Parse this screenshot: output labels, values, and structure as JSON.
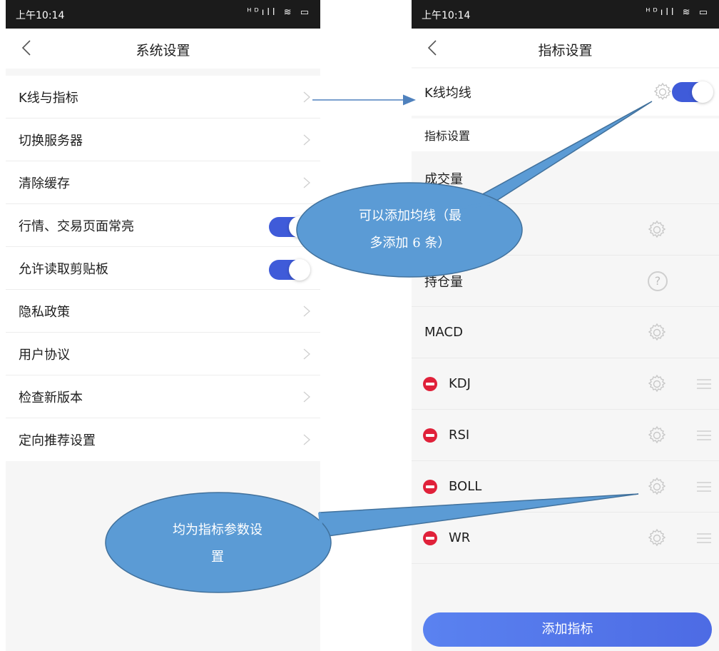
{
  "left": {
    "status_time": "上午10:14",
    "status_icons": "ᴴᴰıll ≋ ▭",
    "nav_title": "系统设置",
    "items": [
      {
        "label": "K线与指标",
        "control": "chevron"
      },
      {
        "label": "切换服务器",
        "control": "chevron"
      },
      {
        "label": "清除缓存",
        "control": "chevron"
      },
      {
        "label": "行情、交易页面常亮",
        "control": "toggle",
        "on": true
      },
      {
        "label": "允许读取剪贴板",
        "control": "toggle",
        "on": true
      },
      {
        "label": "隐私政策",
        "control": "chevron"
      },
      {
        "label": "用户协议",
        "control": "chevron"
      },
      {
        "label": "检查新版本",
        "control": "chevron"
      },
      {
        "label": "定向推荐设置",
        "control": "chevron"
      }
    ]
  },
  "right": {
    "status_time": "上午10:14",
    "status_icons": "ᴴᴰıll ≋ ▭",
    "nav_title": "指标设置",
    "kline_label": "K线均线",
    "kline_toggle_on": true,
    "section_label": "指标设置",
    "rows": [
      {
        "label": "成交量",
        "removable": false,
        "action": "none"
      },
      {
        "label": "",
        "removable": false,
        "action": "gear"
      },
      {
        "label": "持仓量",
        "removable": false,
        "action": "help"
      },
      {
        "label": "MACD",
        "removable": false,
        "action": "gear"
      },
      {
        "label": "KDJ",
        "removable": true,
        "action": "gear"
      },
      {
        "label": "RSI",
        "removable": true,
        "action": "gear"
      },
      {
        "label": "BOLL",
        "removable": true,
        "action": "gear"
      },
      {
        "label": "WR",
        "removable": true,
        "action": "gear"
      }
    ],
    "help_glyph": "?",
    "add_button": "添加指标"
  },
  "annotations": {
    "callout_top_line1": "可以添加均线（最",
    "callout_top_line2": "多添加 6 条）",
    "callout_bottom_line1": "均为指标参数设",
    "callout_bottom_line2": "置"
  },
  "colors": {
    "accent": "#3f5bd9",
    "remove_red": "#e0213a",
    "callout_fill": "#5b9bd5",
    "callout_stroke": "#41719c"
  },
  "icons": {
    "back": "chevron-left-icon",
    "row_chevron": "chevron-right-icon",
    "settings": "gear-icon",
    "help": "help-circle-icon",
    "remove": "minus-circle-icon",
    "drag": "drag-handle-icon"
  }
}
